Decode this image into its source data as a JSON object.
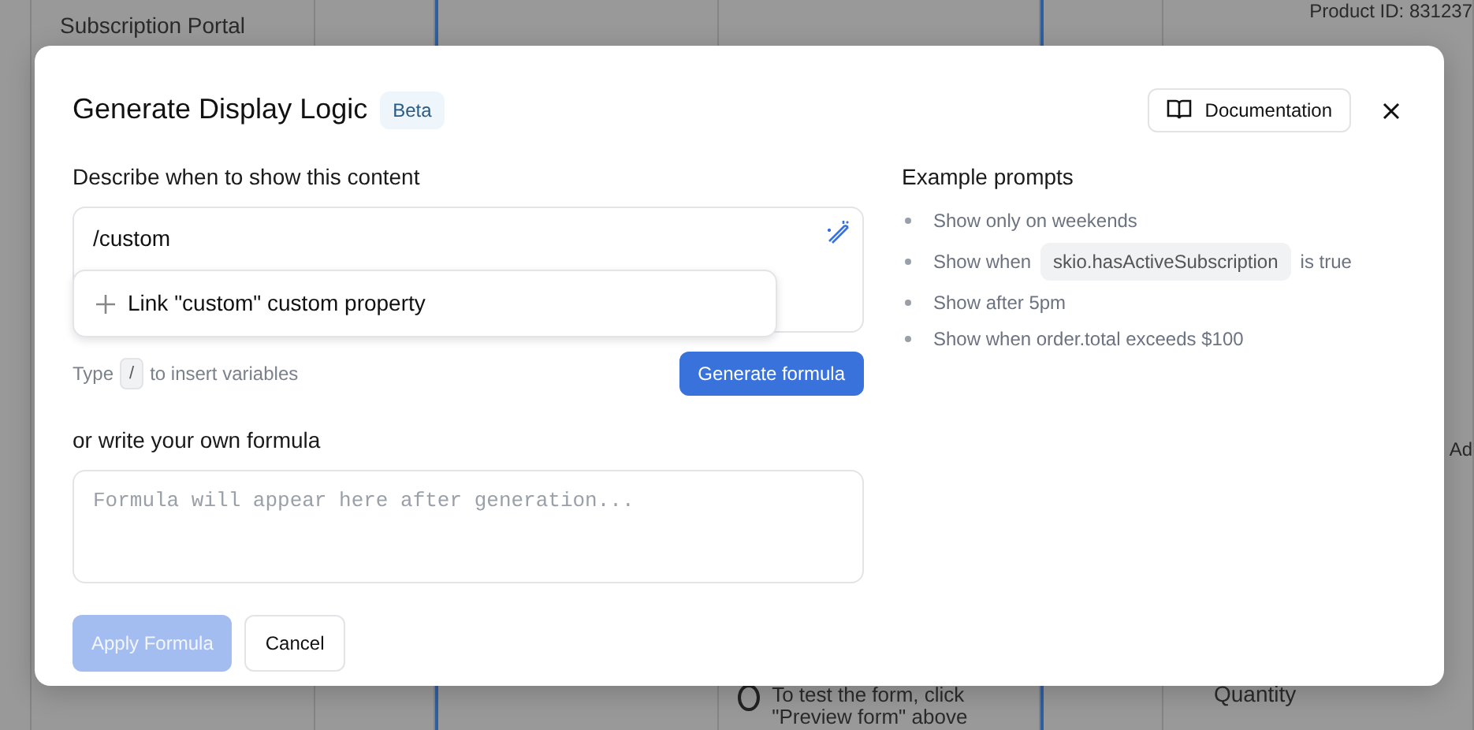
{
  "backdrop": {
    "panel_title": "Subscription Portal",
    "product_id": "Product ID: 831237",
    "form_hint": "To test the form, click \"Preview form\" above",
    "column_label": "Quantity",
    "action_label": "Ad",
    "option_checked": false
  },
  "dialog": {
    "title": "Generate Display Logic",
    "badge": "Beta",
    "documentation_button": "Documentation"
  },
  "prompt": {
    "label": "Describe when to show this content",
    "value": "/custom"
  },
  "suggestion_menu": {
    "items": [
      {
        "label": "Link \"custom\" custom property"
      }
    ]
  },
  "hint": {
    "before": "Type",
    "key": "/",
    "after": "to insert variables"
  },
  "generate_button": "Generate formula",
  "formula": {
    "label": "or write your own formula",
    "placeholder": "Formula will appear here after generation..."
  },
  "buttons": [
    {
      "label": "Apply Formula",
      "kind": "primary",
      "disabled": true
    },
    {
      "label": "Cancel",
      "kind": "secondary",
      "disabled": false
    }
  ],
  "examples": {
    "title": "Example prompts",
    "items": [
      {
        "parts": [
          {
            "kind": "text",
            "text": "Show only on weekends"
          }
        ]
      },
      {
        "parts": [
          {
            "kind": "text",
            "text": "Show when"
          },
          {
            "kind": "code",
            "text": "skio.hasActiveSubscription"
          },
          {
            "kind": "text",
            "text": "is true"
          }
        ]
      },
      {
        "parts": [
          {
            "kind": "text",
            "text": "Show after 5pm"
          }
        ]
      },
      {
        "parts": [
          {
            "kind": "text",
            "text": "Show when order.total exceeds $100"
          }
        ]
      }
    ]
  }
}
